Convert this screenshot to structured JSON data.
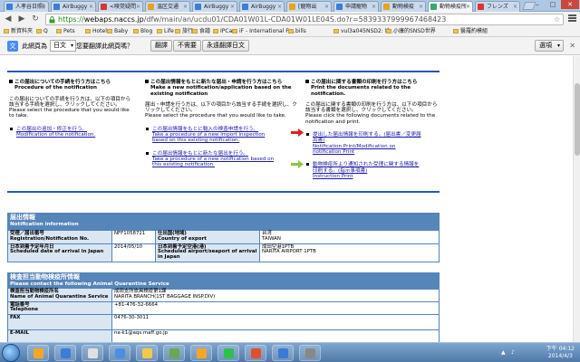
{
  "browser": {
    "tabs": [
      {
        "title": "人孝谷日照(",
        "color": "#3b7dd8"
      },
      {
        "title": "AirBuggy",
        "color": "#3b7dd8"
      },
      {
        "title": "<嗅覚疑問",
        "color": "#d33"
      },
      {
        "title": "温区交通",
        "color": "#e7a321"
      },
      {
        "title": "AirBuggy",
        "color": "#3b7dd8"
      },
      {
        "title": "AirBuggy",
        "color": "#3b7dd8"
      },
      {
        "title": "[寵物出",
        "color": "#e7a321"
      },
      {
        "title": "申請寵物",
        "color": "#3b7dd8"
      },
      {
        "title": "動物検疫",
        "color": "#e7a321"
      },
      {
        "title": "動物検疫所",
        "color": "#3a7",
        "active": true
      },
      {
        "title": "フレンズ",
        "color": "#d33"
      }
    ],
    "window_controls": [
      "–",
      "□",
      "✕"
    ],
    "url": {
      "scheme": "https://",
      "host": "webaps.naccs.jp",
      "path": "/dfw/main/an/ucdu01/CDA01W01L-CDA01W01LE04S.do?r=5839337999967468423"
    },
    "bookmarks": [
      "新資料夾",
      "Q",
      "Pets",
      "Hotel",
      "Baby",
      "Blog",
      "Life",
      "旅行",
      "食譜",
      "IPCam",
      "iF - International Fo...",
      "bills",
      "vul3a045NSD2: 地...",
      "小康的SNSD世界",
      "醫羅約模組"
    ]
  },
  "translate": {
    "prefix": "此網頁為",
    "language": "日文",
    "question": "您要翻譯此網頁嗎？",
    "translate_btn": "翻譯",
    "nope_btn": "不需要",
    "always_btn": "永遠翻譯日文",
    "options": "選項"
  },
  "page": {
    "columns": [
      {
        "heading_jp": "この届出についての手続を行う方はこちら",
        "heading_en": "Procedure of the notification",
        "desc_jp": "この届出についての手続を行う方は、以下の項目から該当する手続を選択し、クリックしてください。",
        "desc_en": "Please select the procedure that you would like to take.",
        "links": [
          {
            "jp": "この届出の追加・修正を行う。",
            "en": "Modification of the notification."
          }
        ]
      },
      {
        "heading_jp": "この届出情報をもとに新たな届出・申請を行う方はこちら",
        "heading_en": "Make a new notification/application based on the existing notification",
        "desc_jp": "届出・申請を行う方は、以下の項目から該当する手続を選択し、クリックしてください。",
        "desc_en": "Please select the procedure that you would like to take.",
        "links": [
          {
            "jp": "この届出情報をもとに輸入の検査申請を行う。",
            "en": "Take a procedure of a new import inspection based on this existing notification."
          },
          {
            "jp": "この届出情報をもとに新たな届出を行う。",
            "en": "Take a procedure of a new notification based on this existing notification."
          }
        ]
      },
      {
        "heading_jp": "この届出に関する書類の印刷を行う方はこちら",
        "heading_en": "Print the documents related to the notification.",
        "desc_jp": "この届出に関する書類の印刷を行う方は、以下の項目から該当する書類を選択し、クリックしてください。",
        "desc_en": "Please click the following documents related to the notification and print.",
        "links": [
          {
            "jp": "提出した届出情報を印刷する。(届出書／変更届出書)",
            "en": "Notification Print/Modification on notification Print"
          },
          {
            "jp": "動物検疫所より通知された受理に関する情報を印刷する。(指示事項書)",
            "en": "Instruction Print"
          }
        ]
      }
    ],
    "arrow_colors": {
      "red": "#e02020",
      "green": "#8cc63f"
    },
    "notification": {
      "title_jp": "届出情報",
      "title_en": "Notification information",
      "rows": [
        {
          "l1_jp": "受理／届出番号",
          "l1_en": "Registration/Notification No.",
          "v1": "NFF1058721",
          "l2_jp": "仕出国(地域)",
          "l2_en": "Country of export",
          "v2": "台湾",
          "v2b": "TAIWAN"
        },
        {
          "l1_jp": "日本到着予定年月日",
          "l1_en": "Scheduled date of arrival in Japan",
          "v1": "2014/05/10",
          "l2_jp": "日本到着予定空港(港)",
          "l2_en": "Scheduled airport/seaport of arrival in Japan",
          "v2": "成田空港1PTB",
          "v2b": "NARITA AIRPORT 1PTB"
        }
      ]
    },
    "quarantine": {
      "title_jp": "検査担当動物検疫所情報",
      "title_en": "Please contact the following Animal Quarantine Service",
      "rows": [
        {
          "label_jp": "検査担当動物検疫所名",
          "label_en": "Name of Animal Quarantine Service",
          "value": "成田支所旅具検疫第1課",
          "value_en": "NARITA BRANCH(1ST BAGGAGE INSP.DIV)"
        },
        {
          "label_jp": "電話番号",
          "label_en": "Telephone",
          "value": "+81-476-32-6664",
          "value_en": ""
        },
        {
          "label_jp": "FAX",
          "label_en": "",
          "value": "0476-30-3011",
          "value_en": ""
        },
        {
          "label_jp": "E-MAIL",
          "label_en": "",
          "value": "na-k1@aqs.maff.go.jp",
          "value_en": ""
        }
      ]
    }
  },
  "taskbar": {
    "apps": [
      "#f4a623",
      "#3b7dd8",
      "#e0e0e0",
      "#4a90e2",
      "#f2c94c",
      "#6aa84f",
      "#f5a623",
      "#2fbf4f",
      "#e04f2f",
      "#3a7bd5",
      "#888888"
    ],
    "time": "下午 04:12",
    "date": "2014/4/3"
  }
}
